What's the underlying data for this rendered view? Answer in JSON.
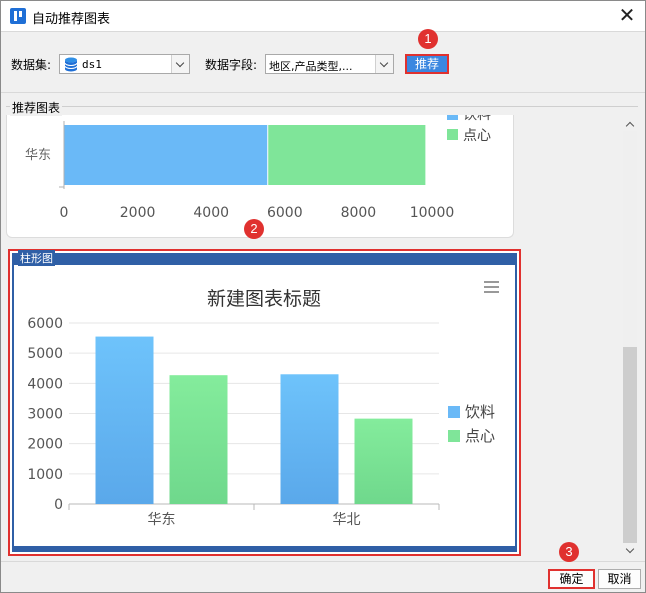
{
  "window": {
    "title": "自动推荐图表",
    "close_glyph": "✕"
  },
  "toolbar": {
    "dataset_label": "数据集:",
    "dataset_value": "ds1",
    "fields_label": "数据字段:",
    "fields_value": "地区,产品类型,...",
    "recommend_label": "推荐"
  },
  "markers": {
    "m1": "1",
    "m2": "2",
    "m3": "3"
  },
  "group": {
    "title": "推荐图表"
  },
  "card1_chart": {
    "type": "bar",
    "orientation": "horizontal",
    "stacked": true,
    "categories": [
      "华东"
    ],
    "series": [
      {
        "name": "饮料",
        "values": [
          5550
        ]
      },
      {
        "name": "点心",
        "values": [
          4270
        ]
      }
    ],
    "xlim": [
      0,
      10000
    ],
    "xticks": [
      "0",
      "2000",
      "4000",
      "6000",
      "8000",
      "10000"
    ],
    "legend_position": "right",
    "colors": [
      "#6ab9f7",
      "#7fe599"
    ]
  },
  "card2": {
    "label": "柱形图",
    "menu_icon": "hamburger-menu-icon"
  },
  "chart_data": {
    "type": "bar",
    "title": "新建图表标题",
    "categories": [
      "华东",
      "华北"
    ],
    "series": [
      {
        "name": "饮料",
        "values": [
          5550,
          4300
        ]
      },
      {
        "name": "点心",
        "values": [
          4270,
          2830
        ]
      }
    ],
    "ylim": [
      0,
      6000
    ],
    "yticks": [
      "0",
      "1000",
      "2000",
      "3000",
      "4000",
      "5000",
      "6000"
    ],
    "grid": true,
    "legend_position": "right",
    "colors": [
      "#6ab9f7",
      "#7fe599"
    ]
  },
  "footer": {
    "ok_label": "确定",
    "cancel_label": "取消"
  },
  "colors": {
    "accent": "#3b87e0",
    "highlight": "#e0312f",
    "card_border": "#2f5fa6"
  }
}
